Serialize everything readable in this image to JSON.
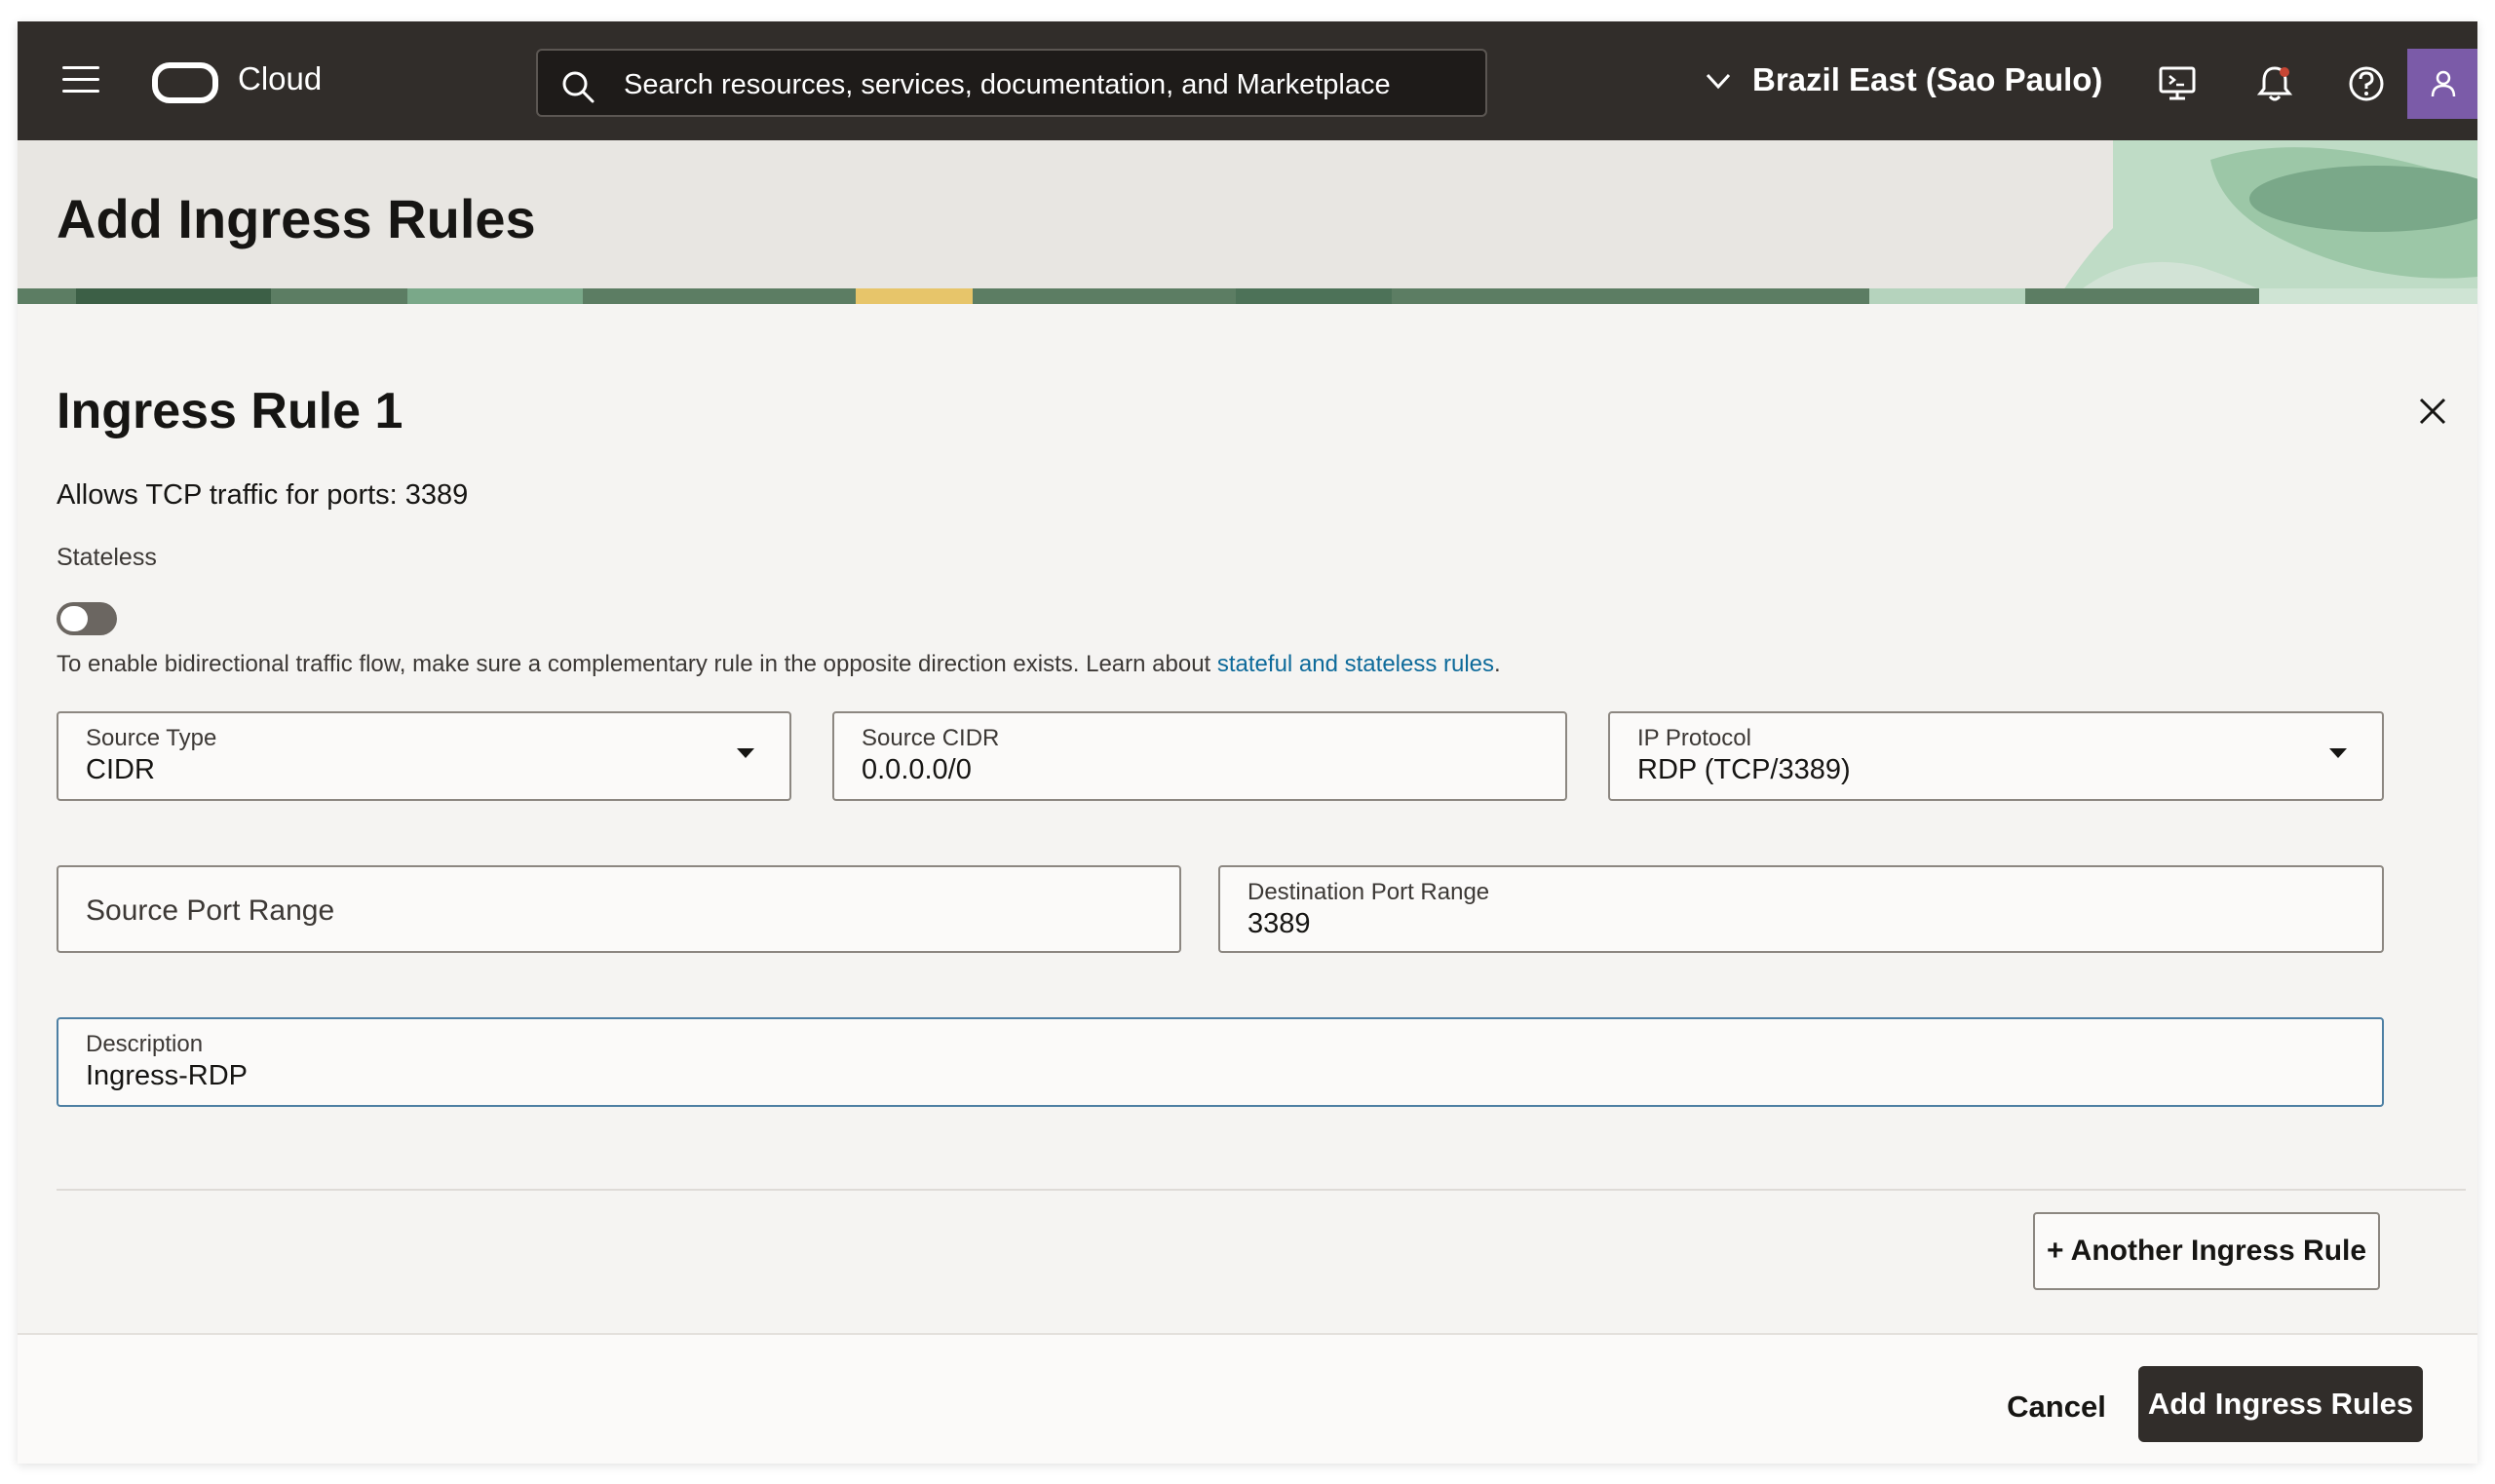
{
  "topbar": {
    "brand": "Cloud",
    "search_placeholder": "Search resources, services, documentation, and Marketplace",
    "region": "Brazil East (Sao Paulo)",
    "icons": [
      "menu-icon",
      "cloud-shell-icon",
      "bell-icon",
      "help-icon",
      "user-icon"
    ]
  },
  "header": {
    "title": "Add Ingress Rules"
  },
  "rule": {
    "title": "Ingress Rule 1",
    "summary": "Allows TCP traffic for ports: 3389",
    "stateless_label": "Stateless",
    "stateless_enabled": false,
    "help_text": "To enable bidirectional traffic flow, make sure a complementary rule in the opposite direction exists. Learn about ",
    "help_link": "stateful and stateless rules",
    "help_suffix": ".",
    "source_type": {
      "label": "Source Type",
      "value": "CIDR"
    },
    "source_cidr": {
      "label": "Source CIDR",
      "value": "0.0.0.0/0"
    },
    "ip_protocol": {
      "label": "IP Protocol",
      "value": "RDP (TCP/3389)"
    },
    "source_port_range": {
      "label": "Source Port Range",
      "value": ""
    },
    "destination_port_range": {
      "label": "Destination Port Range",
      "value": "3389"
    },
    "description": {
      "label": "Description",
      "value": "Ingress-RDP"
    }
  },
  "actions": {
    "another_rule": "+ Another Ingress Rule",
    "cancel": "Cancel",
    "submit": "Add Ingress Rules"
  },
  "colors": {
    "topbar_bg": "#312d2a",
    "link": "#0d6a9a",
    "primary_button": "#312d2a",
    "avatar": "#7b5ba8"
  }
}
